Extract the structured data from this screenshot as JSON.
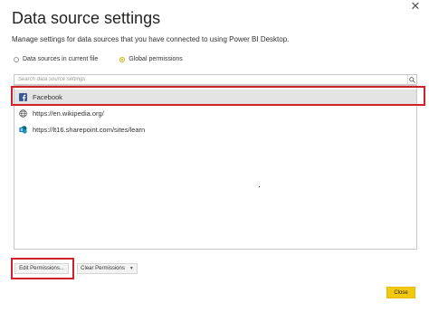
{
  "dialog": {
    "title": "Data source settings",
    "description": "Manage settings for data sources that you have connected to using Power BI Desktop.",
    "close_icon": "✕"
  },
  "scope": {
    "options": [
      {
        "label": "Data sources in current file",
        "selected": false
      },
      {
        "label": "Global permissions",
        "selected": true
      }
    ]
  },
  "search": {
    "placeholder": "Search data source settings"
  },
  "data_sources": [
    {
      "label": "Facebook",
      "icon": "facebook-icon",
      "selected": true
    },
    {
      "label": "https://en.wikipedia.org/",
      "icon": "globe-icon",
      "selected": false
    },
    {
      "label": "https://lt16.sharepoint.com/sites/learn",
      "icon": "sharepoint-icon",
      "selected": false
    }
  ],
  "buttons": {
    "edit_permissions": "Edit Permissions...",
    "clear_permissions": "Clear Permissions",
    "close": "Close"
  },
  "colors": {
    "accent": "#F2C811",
    "highlight": "#D0212B",
    "facebook": "#3B5998",
    "sharepoint": "#0F78D4"
  }
}
